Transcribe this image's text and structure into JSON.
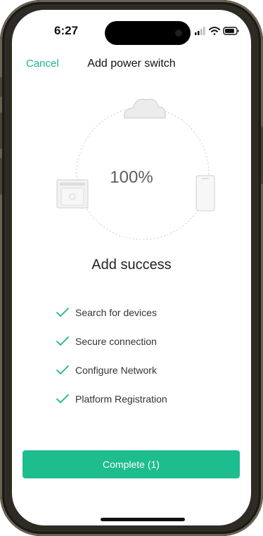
{
  "status_bar": {
    "time": "6:27"
  },
  "nav": {
    "cancel_label": "Cancel",
    "title": "Add power switch"
  },
  "progress": {
    "percent_label": "100%",
    "status_title": "Add success"
  },
  "steps": [
    {
      "label": "Search for devices",
      "done": true
    },
    {
      "label": "Secure connection",
      "done": true
    },
    {
      "label": "Configure Network",
      "done": true
    },
    {
      "label": "Platform Registration",
      "done": true
    }
  ],
  "footer": {
    "complete_label": "Complete (1)"
  },
  "colors": {
    "accent": "#1db58a",
    "button_bg": "#1dbd8e",
    "text_dark": "#222222",
    "text_gray": "#5d5d5d"
  },
  "icons": {
    "cloud": "cloud-icon",
    "gateway": "router-icon",
    "phone": "phone-icon",
    "check": "check-icon",
    "signal": "cellular-signal-icon",
    "wifi": "wifi-icon",
    "battery": "battery-icon"
  }
}
